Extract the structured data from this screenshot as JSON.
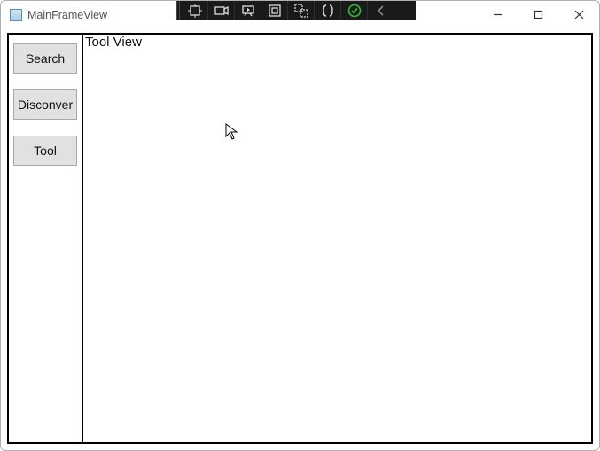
{
  "window": {
    "title": "MainFrameView"
  },
  "toolstrip": {
    "icons": [
      "tool-a",
      "camera",
      "present",
      "square",
      "group",
      "brackets",
      "check",
      "chevron-left"
    ]
  },
  "win_controls": {
    "minimize": "minimize",
    "maximize": "maximize",
    "close": "close"
  },
  "sidebar": {
    "items": [
      {
        "label": "Search"
      },
      {
        "label": "Disconver"
      },
      {
        "label": "Tool"
      }
    ]
  },
  "main": {
    "view_title": "Tool View"
  }
}
